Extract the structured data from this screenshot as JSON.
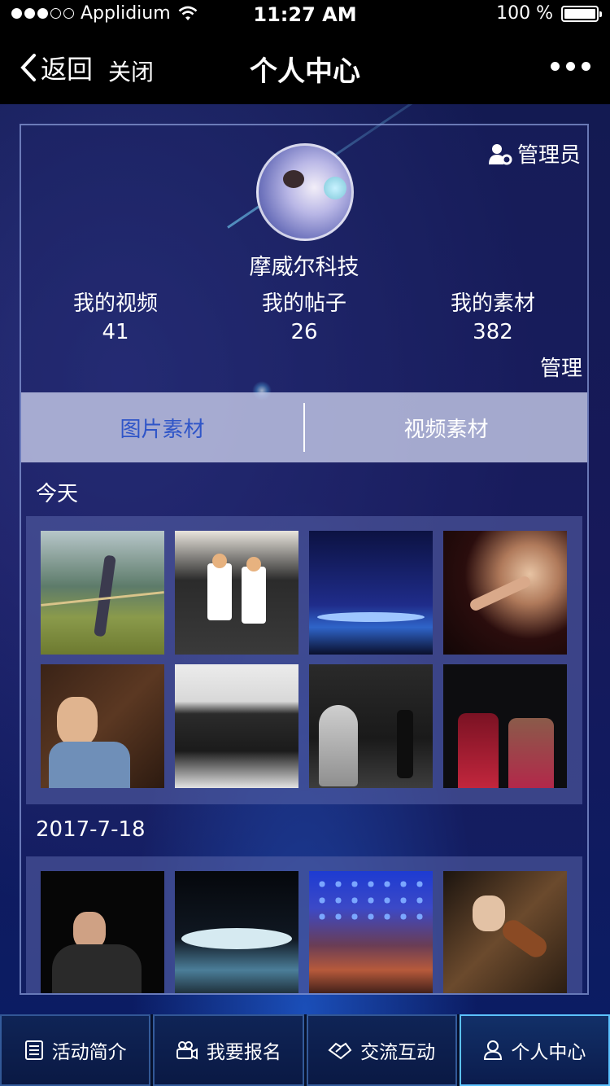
{
  "status_bar": {
    "carrier": "Applidium",
    "time": "11:27 AM",
    "battery": "100 %"
  },
  "nav": {
    "back": "返回",
    "close": "关闭",
    "title": "个人中心"
  },
  "profile": {
    "role": "管理员",
    "name": "摩威尔科技",
    "stats": [
      {
        "label": "我的视频",
        "value": "41"
      },
      {
        "label": "我的帖子",
        "value": "26"
      },
      {
        "label": "我的素材",
        "value": "382"
      }
    ],
    "manage": "管理"
  },
  "tabs": [
    {
      "label": "图片素材"
    },
    {
      "label": "视频素材"
    }
  ],
  "sections": [
    {
      "label": "今天"
    },
    {
      "label": "2017-7-18"
    }
  ],
  "tabbar": [
    {
      "label": "活动简介",
      "icon": "list-icon"
    },
    {
      "label": "我要报名",
      "icon": "camera-icon"
    },
    {
      "label": "交流互动",
      "icon": "handshake-icon"
    },
    {
      "label": "个人中心",
      "icon": "user-icon"
    }
  ]
}
